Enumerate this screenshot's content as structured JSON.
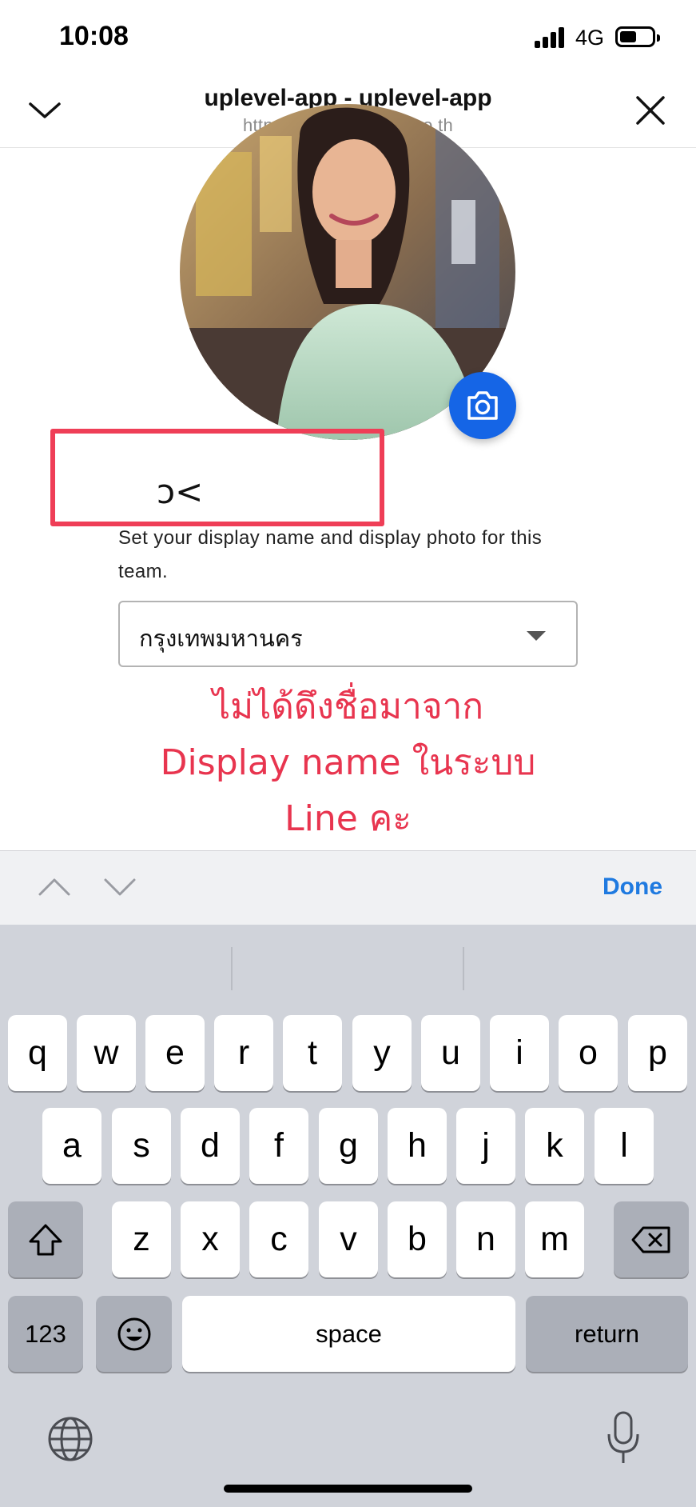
{
  "status_bar": {
    "time": "10:08",
    "network": "4G"
  },
  "header": {
    "title": "uplevel-app - uplevel-app",
    "url": "https://uplevel.pointit.co.th",
    "left_icon": "chevron-down-icon",
    "right_icon": "close-icon"
  },
  "profile": {
    "camera_icon": "camera-icon",
    "display_name": "ɔ<",
    "helper_text": "Set your display name and display photo for this team.",
    "province": "กรุงเทพมหานคร"
  },
  "annotation": {
    "lines": [
      "ไม่ได้ดึงชื่อมาจาก",
      "Display name ในระบบ",
      "Line คะ"
    ],
    "color": "#e8354f",
    "box_color": "#ef3e57"
  },
  "keyboard_toolbar": {
    "done_label": "Done"
  },
  "keyboard": {
    "row1": [
      "q",
      "w",
      "e",
      "r",
      "t",
      "y",
      "u",
      "i",
      "o",
      "p"
    ],
    "row2": [
      "a",
      "s",
      "d",
      "f",
      "g",
      "h",
      "j",
      "k",
      "l"
    ],
    "row3": [
      "z",
      "x",
      "c",
      "v",
      "b",
      "n",
      "m"
    ],
    "numbers_label": "123",
    "space_label": "space",
    "return_label": "return"
  },
  "colors": {
    "accent": "#1565e6",
    "done_blue": "#1f7ae0"
  }
}
